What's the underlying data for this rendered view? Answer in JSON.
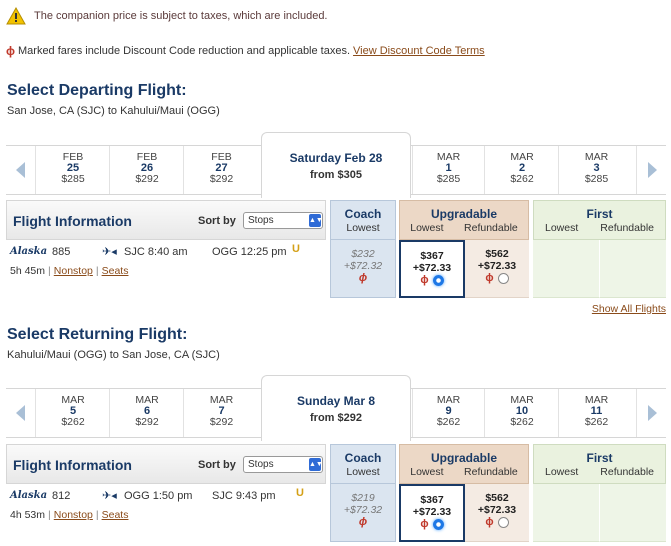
{
  "notices": {
    "companion": "The companion price is subject to taxes, which are included.",
    "marked": "Marked fares include Discount Code reduction and applicable taxes.",
    "terms_link": "View Discount Code Terms"
  },
  "columns": {
    "flight_info": "Flight Information",
    "sort_by": "Sort by",
    "sort_value": "Stops",
    "coach": "Coach",
    "coach_sub": "Lowest",
    "upgradable": "Upgradable",
    "upg_lowest": "Lowest",
    "upg_refundable": "Refundable",
    "first": "First",
    "first_lowest": "Lowest",
    "first_refundable": "Refundable"
  },
  "departing": {
    "title": "Select Departing Flight:",
    "route": "San Jose, CA (SJC) to Kahului/Maui (OGG)",
    "dates": [
      {
        "mon": "FEB",
        "day": "25",
        "price": "$285"
      },
      {
        "mon": "FEB",
        "day": "26",
        "price": "$292"
      },
      {
        "mon": "FEB",
        "day": "27",
        "price": "$292"
      },
      {
        "mon": "MAR",
        "day": "1",
        "price": "$285"
      },
      {
        "mon": "MAR",
        "day": "2",
        "price": "$262"
      },
      {
        "mon": "MAR",
        "day": "3",
        "price": "$285"
      }
    ],
    "selected_date": "Saturday Feb 28",
    "selected_from": "from $305",
    "flight": {
      "airline": "Alaska",
      "number": "885",
      "dep": "SJC  8:40 am",
      "arr": "OGG  12:25 pm",
      "upgrade_mark": "U",
      "duration": "5h 45m",
      "stops": "Nonstop",
      "seats": "Seats",
      "coach_price": "$232",
      "coach_tax": "+$72.32",
      "upg_low_price": "$367",
      "upg_low_tax": "+$72.33",
      "upg_ref_price": "$562",
      "upg_ref_tax": "+$72.33"
    }
  },
  "show_all": "Show All Flights",
  "returning": {
    "title": "Select Returning Flight:",
    "route": "Kahului/Maui (OGG) to San Jose, CA (SJC)",
    "dates": [
      {
        "mon": "MAR",
        "day": "5",
        "price": "$262"
      },
      {
        "mon": "MAR",
        "day": "6",
        "price": "$292"
      },
      {
        "mon": "MAR",
        "day": "7",
        "price": "$292"
      },
      {
        "mon": "MAR",
        "day": "9",
        "price": "$262"
      },
      {
        "mon": "MAR",
        "day": "10",
        "price": "$262"
      },
      {
        "mon": "MAR",
        "day": "11",
        "price": "$262"
      }
    ],
    "selected_date": "Sunday Mar 8",
    "selected_from": "from $292",
    "flight": {
      "airline": "Alaska",
      "number": "812",
      "dep": "OGG  1:50 pm",
      "arr": "SJC  9:43 pm",
      "upgrade_mark": "U",
      "duration": "4h 53m",
      "stops": "Nonstop",
      "seats": "Seats",
      "coach_price": "$219",
      "coach_tax": "+$72.32",
      "upg_low_price": "$367",
      "upg_low_tax": "+$72.33",
      "upg_ref_price": "$562",
      "upg_ref_tax": "+$72.33"
    }
  }
}
